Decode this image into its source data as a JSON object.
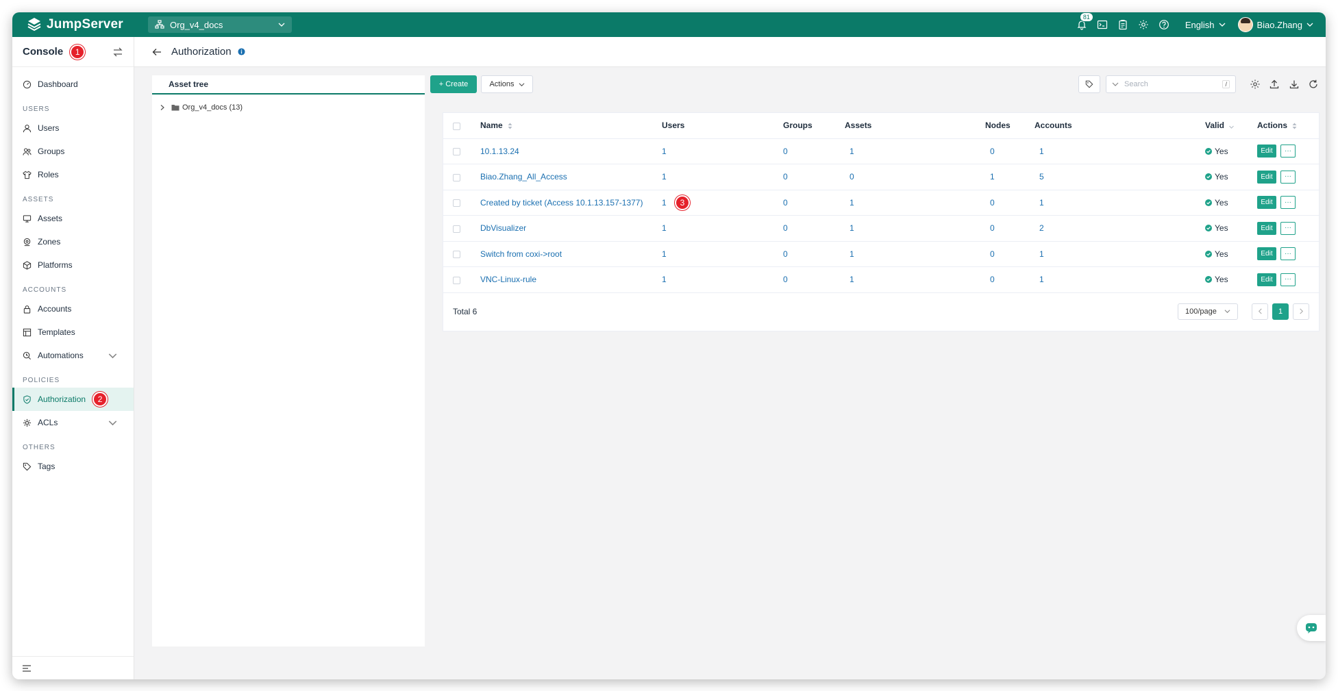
{
  "app": {
    "logo_text": "JumpServer",
    "org": "Org_v4_docs",
    "notifications_count": "81",
    "language": "English",
    "user_name": "Biao.Zhang"
  },
  "sidebar": {
    "title": "Console",
    "title_badge": "1",
    "sections": [
      {
        "label": "",
        "items": [
          {
            "label": "Dashboard"
          }
        ]
      },
      {
        "label": "USERS",
        "items": [
          {
            "label": "Users"
          },
          {
            "label": "Groups"
          },
          {
            "label": "Roles"
          }
        ]
      },
      {
        "label": "ASSETS",
        "items": [
          {
            "label": "Assets"
          },
          {
            "label": "Zones"
          },
          {
            "label": "Platforms"
          }
        ]
      },
      {
        "label": "ACCOUNTS",
        "items": [
          {
            "label": "Accounts"
          },
          {
            "label": "Templates"
          },
          {
            "label": "Automations"
          }
        ]
      },
      {
        "label": "POLICIES",
        "items": [
          {
            "label": "Authorization",
            "badge": "2"
          },
          {
            "label": "ACLs"
          }
        ]
      },
      {
        "label": "OTHERS",
        "items": [
          {
            "label": "Tags"
          }
        ]
      }
    ]
  },
  "page": {
    "title": "Authorization"
  },
  "tree": {
    "header": "Asset tree",
    "root": "Org_v4_docs (13)"
  },
  "toolbar": {
    "create_label": "+ Create",
    "actions_label": "Actions",
    "search_placeholder": "Search",
    "search_shortcut": "/"
  },
  "table": {
    "columns": {
      "name": "Name",
      "users": "Users",
      "groups": "Groups",
      "assets": "Assets",
      "nodes": "Nodes",
      "accounts": "Accounts",
      "valid": "Valid",
      "actions": "Actions"
    },
    "rows": [
      {
        "name": "10.1.13.24",
        "users": "1",
        "groups": "0",
        "assets": "1",
        "nodes": "0",
        "accounts": "1",
        "valid": "Yes"
      },
      {
        "name": "Biao.Zhang_All_Access",
        "users": "1",
        "groups": "0",
        "assets": "0",
        "nodes": "1",
        "accounts": "5",
        "valid": "Yes"
      },
      {
        "name": "Created by ticket (Access 10.1.13.157-1377)",
        "badge": "3",
        "users": "1",
        "groups": "0",
        "assets": "1",
        "nodes": "0",
        "accounts": "1",
        "valid": "Yes"
      },
      {
        "name": "DbVisualizer",
        "users": "1",
        "groups": "0",
        "assets": "1",
        "nodes": "0",
        "accounts": "2",
        "valid": "Yes"
      },
      {
        "name": "Switch from coxi->root",
        "users": "1",
        "groups": "0",
        "assets": "1",
        "nodes": "0",
        "accounts": "1",
        "valid": "Yes"
      },
      {
        "name": "VNC-Linux-rule",
        "users": "1",
        "groups": "0",
        "assets": "1",
        "nodes": "0",
        "accounts": "1",
        "valid": "Yes"
      }
    ],
    "edit_label": "Edit",
    "more_label": "···",
    "total": "Total 6",
    "per_page": "100/page",
    "current_page": "1"
  },
  "colors": {
    "brand": "#0b7a68",
    "primary": "#1fa28a",
    "link": "#1a6fb0",
    "badge": "#e5212b"
  }
}
